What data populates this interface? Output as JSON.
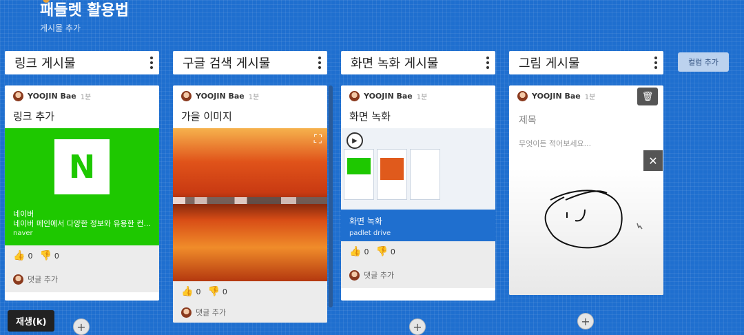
{
  "header": {
    "title": "패들렛 활용법",
    "subtitle": "게시물 추가"
  },
  "add_column_label": "컬럼 추가",
  "columns": [
    {
      "title": "링크 게시물"
    },
    {
      "title": "구글 검색 게시물"
    },
    {
      "title": "화면 녹화 게시물"
    },
    {
      "title": "그림 게시물"
    }
  ],
  "cards": {
    "link": {
      "author": "YOOJIN Bae",
      "time": "1분",
      "title": "링크 추가",
      "logo_letter": "N",
      "link_title": "네이버",
      "link_desc": "네이버 메인에서 다양한 정보와 유용한 컨...",
      "link_source": "naver",
      "likes": "0",
      "dislikes": "0",
      "comment_label": "댓글 추가"
    },
    "google": {
      "author": "YOOJIN Bae",
      "time": "1분",
      "title": "가을 이미지",
      "likes": "0",
      "dislikes": "0",
      "comment_label": "댓글 추가"
    },
    "video": {
      "author": "YOOJIN Bae",
      "time": "1분",
      "title": "화면 녹화",
      "caption_title": "화면 녹화",
      "caption_sub": "padlet drive",
      "likes": "0",
      "dislikes": "0",
      "comment_label": "댓글 추가"
    },
    "drawing": {
      "author": "YOOJIN Bae",
      "time": "1분",
      "title_placeholder": "제목",
      "body_placeholder": "무엇이든 적어보세요..."
    }
  },
  "tooltip": "재생(k)",
  "colors": {
    "background": "#1f6fcf",
    "naver_green": "#1ec800"
  },
  "icons": [
    "kebab-icon",
    "thumbs-up-icon",
    "thumbs-down-icon",
    "trash-icon",
    "close-icon",
    "plus-icon",
    "play-icon",
    "expand-icon"
  ]
}
